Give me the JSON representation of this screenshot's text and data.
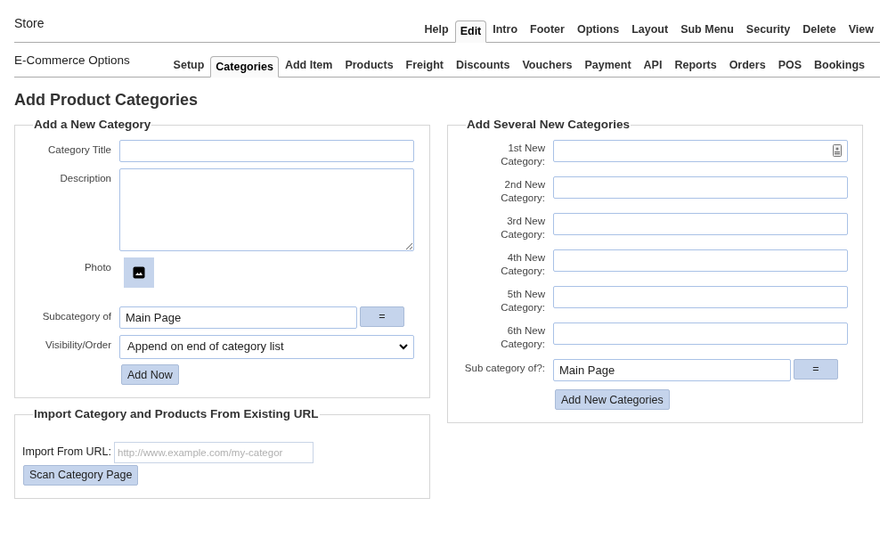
{
  "header": {
    "title": "Store",
    "tabs": [
      {
        "label": "Help",
        "selected": false
      },
      {
        "label": "Edit",
        "selected": true
      },
      {
        "label": "Intro",
        "selected": false
      },
      {
        "label": "Footer",
        "selected": false
      },
      {
        "label": "Options",
        "selected": false
      },
      {
        "label": "Layout",
        "selected": false
      },
      {
        "label": "Sub Menu",
        "selected": false
      },
      {
        "label": "Security",
        "selected": false
      },
      {
        "label": "Delete",
        "selected": false
      },
      {
        "label": "View",
        "selected": false
      }
    ]
  },
  "subheader": {
    "title": "E-Commerce Options",
    "tabs": [
      {
        "label": "Setup",
        "selected": false
      },
      {
        "label": "Categories",
        "selected": true
      },
      {
        "label": "Add Item",
        "selected": false
      },
      {
        "label": "Products",
        "selected": false
      },
      {
        "label": "Freight",
        "selected": false
      },
      {
        "label": "Discounts",
        "selected": false
      },
      {
        "label": "Vouchers",
        "selected": false
      },
      {
        "label": "Payment",
        "selected": false
      },
      {
        "label": "API",
        "selected": false
      },
      {
        "label": "Reports",
        "selected": false
      },
      {
        "label": "Orders",
        "selected": false
      },
      {
        "label": "POS",
        "selected": false
      },
      {
        "label": "Bookings",
        "selected": false
      }
    ]
  },
  "page_title": "Add Product Categories",
  "add_category": {
    "title": "Add a New Category",
    "fields": [
      {
        "kind": "text",
        "label": "Category Title"
      },
      {
        "kind": "textarea",
        "label": "Description"
      },
      {
        "kind": "photo",
        "label": "Photo"
      },
      {
        "kind": "picker",
        "label": "Subcategory of",
        "value": "Main Page",
        "button": "="
      },
      {
        "kind": "select",
        "label": "Visibility/Order",
        "value": "Append on end of category list"
      }
    ],
    "submit": "Add Now"
  },
  "import": {
    "title": "Import Category and Products From Existing URL",
    "label": "Import From URL:",
    "placeholder": "http://www.example.com/my-categor",
    "button": "Scan Category Page"
  },
  "several": {
    "title": "Add Several New Categories",
    "fields": [
      {
        "label": "1st New Category:",
        "autofill": true
      },
      {
        "label": "2nd New Category:",
        "autofill": false
      },
      {
        "label": "3rd New Category:",
        "autofill": false
      },
      {
        "label": "4th New Category:",
        "autofill": false
      },
      {
        "label": "5th New Category:",
        "autofill": false
      },
      {
        "label": "6th New Category:",
        "autofill": false
      }
    ],
    "sub_label": "Sub category of?:",
    "sub_value": "Main Page",
    "sub_button": "=",
    "submit": "Add New Categories"
  }
}
